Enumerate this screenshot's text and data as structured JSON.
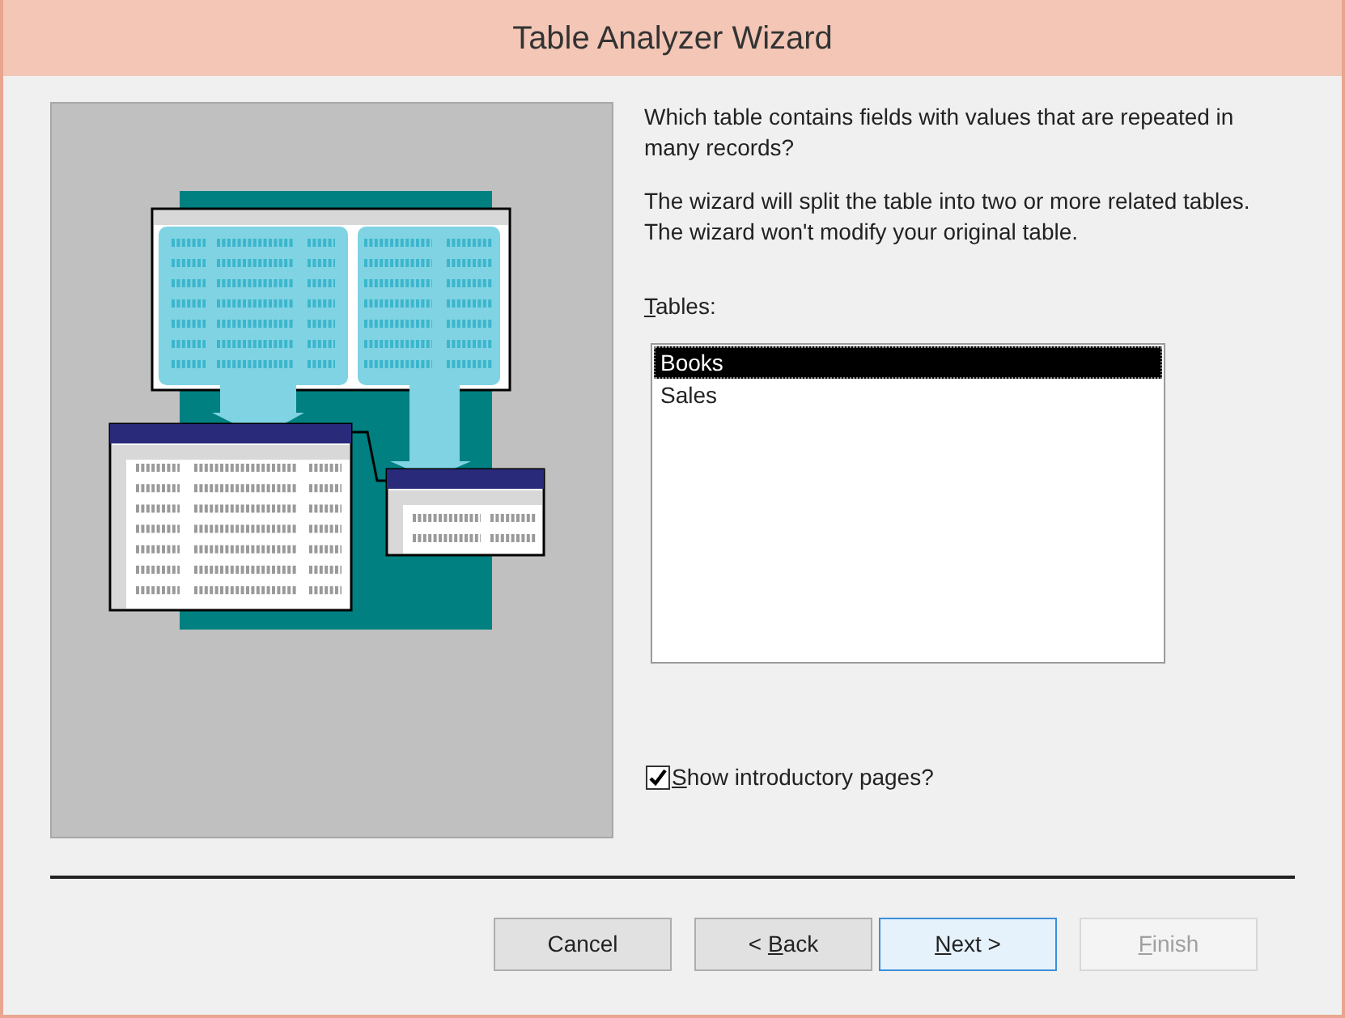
{
  "window": {
    "title": "Table Analyzer Wizard"
  },
  "question": "Which table contains fields with values that are repeated in many records?",
  "description": [
    "The wizard will split the table into two or more related tables.",
    "The wizard won't modify your original table."
  ],
  "tables": {
    "label": "Tables:",
    "key_underlined": true,
    "items": [
      {
        "label": "Books",
        "selected": true
      },
      {
        "label": "Sales",
        "selected": false
      }
    ]
  },
  "show_intro": {
    "label": "Show introductory pages?",
    "key_underlined": true,
    "checked": true
  },
  "buttons": [
    {
      "label": "Cancel",
      "key_underlined": false,
      "default": false,
      "disabled": false
    },
    {
      "label": "< Back",
      "key_underlined": true,
      "default": false,
      "disabled": false
    },
    {
      "label": "Next >",
      "key_underlined": true,
      "default": true,
      "disabled": false
    },
    {
      "label": "Finish",
      "key_underlined": true,
      "default": false,
      "disabled": true
    }
  ]
}
